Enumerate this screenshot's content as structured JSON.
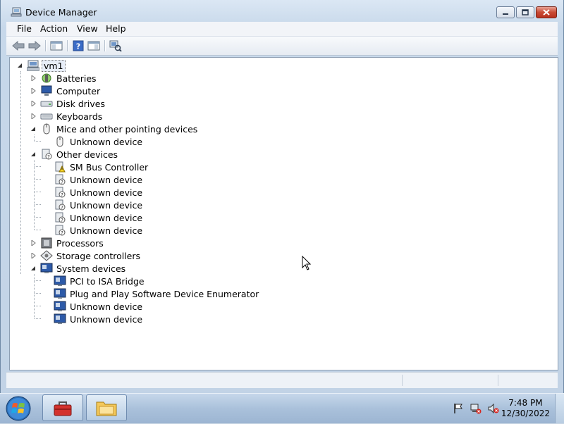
{
  "window": {
    "title": "Device Manager"
  },
  "menu": [
    "File",
    "Action",
    "View",
    "Help"
  ],
  "toolbar": {
    "icons": [
      "back-arrow-icon",
      "forward-arrow-icon",
      "show-hide-console-tree-icon",
      "help-icon",
      "properties-icon",
      "scan-hardware-icon"
    ]
  },
  "tree": {
    "root": {
      "label": "vm1",
      "icon": "computer-icon"
    },
    "categories": [
      {
        "label": "Batteries",
        "icon": "battery-icon",
        "expanded": false,
        "children": []
      },
      {
        "label": "Computer",
        "icon": "monitor-icon",
        "expanded": false,
        "children": []
      },
      {
        "label": "Disk drives",
        "icon": "disk-drive-icon",
        "expanded": false,
        "children": []
      },
      {
        "label": "Keyboards",
        "icon": "keyboard-icon",
        "expanded": false,
        "children": []
      },
      {
        "label": "Mice and other pointing devices",
        "icon": "mouse-icon",
        "expanded": true,
        "children": [
          {
            "label": "Unknown device",
            "icon": "mouse-icon"
          }
        ]
      },
      {
        "label": "Other devices",
        "icon": "unknown-device-icon",
        "expanded": true,
        "children": [
          {
            "label": "SM Bus Controller",
            "icon": "warning-device-icon"
          },
          {
            "label": "Unknown device",
            "icon": "unknown-device-icon"
          },
          {
            "label": "Unknown device",
            "icon": "unknown-device-icon"
          },
          {
            "label": "Unknown device",
            "icon": "unknown-device-icon"
          },
          {
            "label": "Unknown device",
            "icon": "unknown-device-icon"
          },
          {
            "label": "Unknown device",
            "icon": "unknown-device-icon"
          }
        ]
      },
      {
        "label": "Processors",
        "icon": "processor-icon",
        "expanded": false,
        "children": []
      },
      {
        "label": "Storage controllers",
        "icon": "storage-controller-icon",
        "expanded": false,
        "children": []
      },
      {
        "label": "System devices",
        "icon": "system-device-icon",
        "expanded": true,
        "children": [
          {
            "label": "PCI to ISA Bridge",
            "icon": "system-device-icon"
          },
          {
            "label": "Plug and Play Software Device Enumerator",
            "icon": "system-device-icon"
          },
          {
            "label": "Unknown device",
            "icon": "system-device-icon"
          },
          {
            "label": "Unknown device",
            "icon": "system-device-icon"
          }
        ]
      }
    ]
  },
  "taskbar": {
    "clock_time": "7:48 PM",
    "clock_date": "12/30/2022",
    "pinned": [
      "toolbox-icon",
      "file-explorer-icon"
    ],
    "tray": [
      "action-center-flag-icon",
      "network-icon",
      "volume-muted-icon"
    ]
  }
}
